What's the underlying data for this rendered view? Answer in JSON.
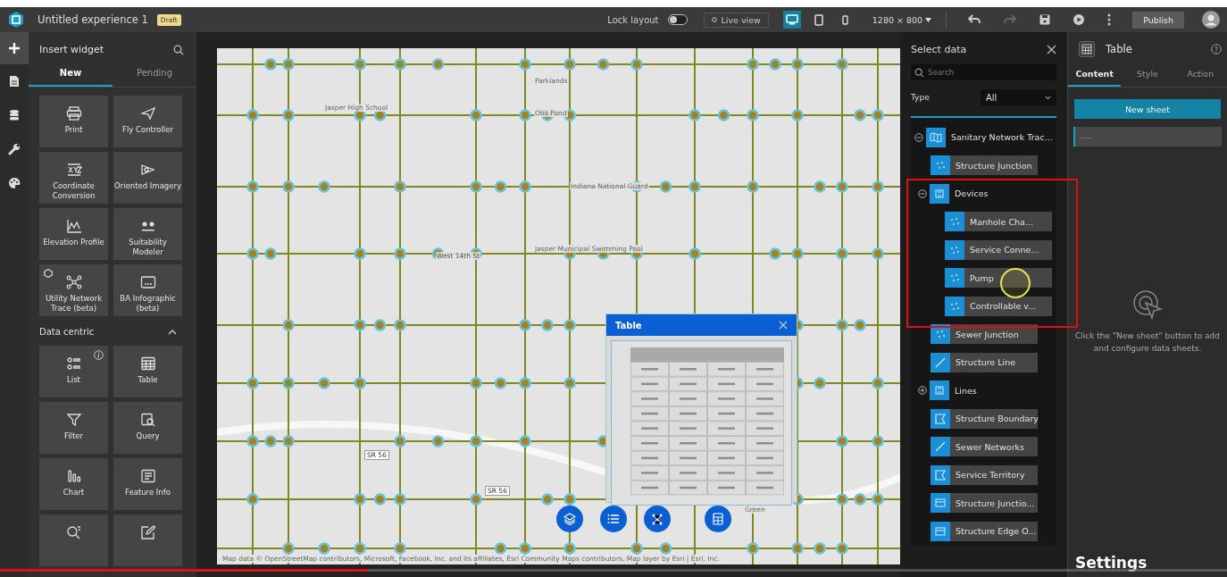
{
  "header": {
    "title": "Untitled experience 1",
    "badge": "Draft",
    "lock_layout": {
      "label": "Lock layout",
      "on": false
    },
    "live_view": "Live view",
    "devices": [
      {
        "kind": "desktop",
        "selected": true
      },
      {
        "kind": "tablet",
        "selected": false
      },
      {
        "kind": "phone",
        "selected": false
      }
    ],
    "resolution": "1280 × 800",
    "publish": "Publish"
  },
  "rail": [
    {
      "kind": "plus",
      "selected": true
    },
    {
      "kind": "page",
      "selected": false
    },
    {
      "kind": "data",
      "selected": false
    },
    {
      "kind": "wrench",
      "selected": false
    },
    {
      "kind": "palette",
      "selected": false
    }
  ],
  "insert_panel": {
    "title": "Insert widget",
    "tabs": [
      {
        "label": "New",
        "selected": true
      },
      {
        "label": "Pending",
        "selected": false
      }
    ],
    "widgets": [
      {
        "label": "Print",
        "kind": "print"
      },
      {
        "label": "Fly Controller",
        "kind": "plane"
      },
      {
        "label": "Coordinate Conversion",
        "kind": "xyz"
      },
      {
        "label": "Oriented Imagery",
        "kind": "camera"
      },
      {
        "label": "Elevation Profile",
        "kind": "profile"
      },
      {
        "label": "Suitability Modeler",
        "kind": "model"
      },
      {
        "label": "Utility Network Trace (beta)",
        "kind": "network",
        "badge": true
      },
      {
        "label": "BA Infographic (beta)",
        "kind": "infographic",
        "badge": false
      }
    ],
    "section": {
      "title": "Data centric",
      "expanded": true
    },
    "data_widgets": [
      {
        "label": "List",
        "kind": "list",
        "info": true
      },
      {
        "label": "Table",
        "kind": "table",
        "info": false
      },
      {
        "label": "Filter",
        "kind": "filter"
      },
      {
        "label": "Query",
        "kind": "query"
      },
      {
        "label": "Chart",
        "kind": "chart"
      },
      {
        "label": "Feature Info",
        "kind": "info"
      },
      {
        "kind": "search"
      },
      {
        "kind": "edit"
      }
    ]
  },
  "map": {
    "labels": [
      {
        "text": "Parklands",
        "kind": "place"
      },
      {
        "text": "Otis Pond",
        "kind": "place"
      },
      {
        "text": "Jasper High School",
        "kind": "place"
      },
      {
        "text": "Indiana National Guard",
        "kind": "place"
      },
      {
        "text": "Jasper Municipal Swimming Pool",
        "kind": "place"
      },
      {
        "text": "West 14th St",
        "kind": "street"
      },
      {
        "text": "SR 56",
        "kind": "shield"
      },
      {
        "text": "SR 56",
        "kind": "shield"
      },
      {
        "text": "Green",
        "kind": "place"
      }
    ],
    "attribution": "Map data © OpenStreetMap contributors, Microsoft, Facebook, Inc. and its affiliates, Esri Community Maps contributors, Map layer by Esri | Esri, Inc.",
    "table_widget": {
      "title": "Table"
    },
    "tools": [
      {
        "kind": "layers"
      },
      {
        "kind": "list"
      },
      {
        "kind": "network"
      },
      {
        "kind": "table"
      }
    ]
  },
  "select_data": {
    "title": "Select data",
    "search_placeholder": "Search",
    "type_label": "Type",
    "type_value": "All",
    "tree": [
      {
        "label": "Sanitary Network Trac...",
        "kind": "map",
        "expanded": true,
        "children": [
          {
            "label": "Structure Junction",
            "kind": "point"
          },
          {
            "label": "Devices",
            "kind": "group",
            "expanded": true,
            "children": [
              {
                "label": "Manhole Cha...",
                "kind": "point"
              },
              {
                "label": "Service Conne...",
                "kind": "point"
              },
              {
                "label": "Pump",
                "kind": "point"
              },
              {
                "label": "Controllable v...",
                "kind": "point"
              }
            ]
          },
          {
            "label": "Sewer Junction",
            "kind": "point"
          },
          {
            "label": "Structure Line",
            "kind": "line"
          },
          {
            "label": "Lines",
            "kind": "group",
            "expanded": false
          },
          {
            "label": "Structure Boundary",
            "kind": "polygon"
          },
          {
            "label": "Sewer Networks",
            "kind": "line"
          },
          {
            "label": "Service Territory",
            "kind": "polygon"
          },
          {
            "label": "Structure Junctio...",
            "kind": "table"
          },
          {
            "label": "Structure Edge O...",
            "kind": "table"
          }
        ]
      }
    ]
  },
  "settings": {
    "title": "Table",
    "tabs": [
      {
        "label": "Content",
        "selected": true
      },
      {
        "label": "Style",
        "selected": false
      },
      {
        "label": "Action",
        "selected": false
      }
    ],
    "new_sheet": "New sheet",
    "sheet_field": "......",
    "hint": "Click the \"New sheet\" button to add and configure data sheets.",
    "caption": "Settings"
  },
  "video_progress": {
    "level": 0.3
  }
}
